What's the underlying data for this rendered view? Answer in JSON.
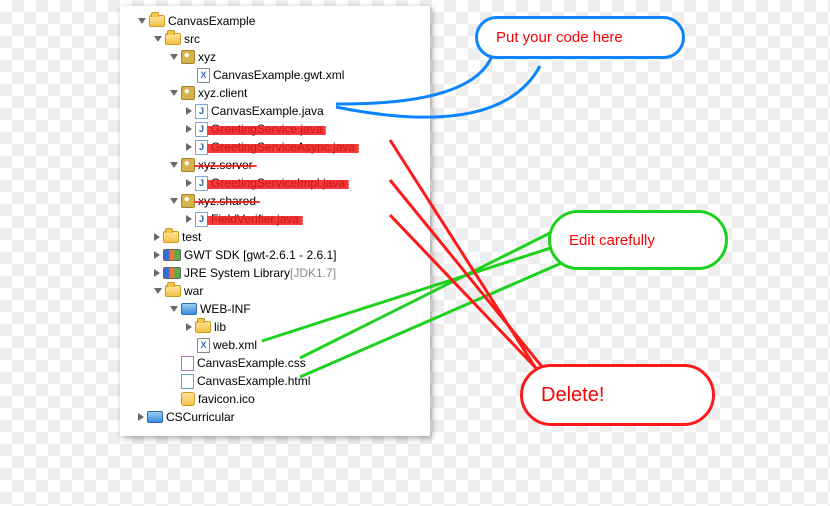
{
  "tree": {
    "root": "CanvasExample",
    "src": "src",
    "pkg1": "xyz",
    "file_gwt": "CanvasExample.gwt.xml",
    "pkg2": "xyz.client",
    "file_java": "CanvasExample.java",
    "del_greeting": "GreetingService.java",
    "del_greeting_async": "GreetingServiceAsync.java",
    "pkg3": "xyz.server",
    "del_greeting_impl": "GreetingServiceImpl.java",
    "pkg4": "xyz.shared",
    "del_field_verifier": "FieldVerifier.java",
    "test": "test",
    "gwt_sdk": "GWT SDK [gwt-2.6.1 - 2.6.1]",
    "jre": "JRE System Library",
    "jre_deco": " [JDK1.7]",
    "war": "war",
    "webinf": "WEB-INF",
    "lib": "lib",
    "webxml": "web.xml",
    "css": "CanvasExample.css",
    "html": "CanvasExample.html",
    "favicon": "favicon.ico",
    "sibling": "CSCurricular"
  },
  "callouts": {
    "put_code": "Put your code here",
    "edit": "Edit carefully",
    "delete": "Delete!"
  }
}
